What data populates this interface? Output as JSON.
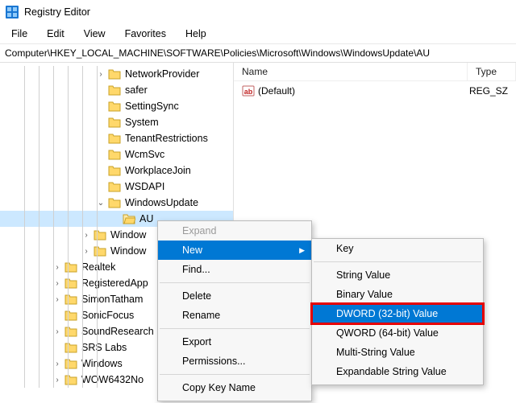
{
  "titlebar": {
    "title": "Registry Editor"
  },
  "menus": {
    "file": "File",
    "edit": "Edit",
    "view": "View",
    "favorites": "Favorites",
    "help": "Help"
  },
  "address": "Computer\\HKEY_LOCAL_MACHINE\\SOFTWARE\\Policies\\Microsoft\\Windows\\WindowsUpdate\\AU",
  "list": {
    "col_name": "Name",
    "col_type": "Type",
    "rows": [
      {
        "name": "(Default)",
        "type": "REG_SZ"
      }
    ]
  },
  "tree": [
    {
      "depth": 6,
      "chev": ">",
      "label": "NetworkProvider"
    },
    {
      "depth": 6,
      "chev": "",
      "label": "safer"
    },
    {
      "depth": 6,
      "chev": "",
      "label": "SettingSync"
    },
    {
      "depth": 6,
      "chev": "",
      "label": "System"
    },
    {
      "depth": 6,
      "chev": "",
      "label": "TenantRestrictions"
    },
    {
      "depth": 6,
      "chev": "",
      "label": "WcmSvc"
    },
    {
      "depth": 6,
      "chev": "",
      "label": "WorkplaceJoin"
    },
    {
      "depth": 6,
      "chev": "",
      "label": "WSDAPI"
    },
    {
      "depth": 6,
      "chev": "v",
      "label": "WindowsUpdate"
    },
    {
      "depth": 7,
      "chev": "",
      "label": "AU",
      "selected": true
    },
    {
      "depth": 5,
      "chev": ">",
      "label": "Window"
    },
    {
      "depth": 5,
      "chev": ">",
      "label": "Window"
    },
    {
      "depth": 3,
      "chev": ">",
      "label": "Realtek"
    },
    {
      "depth": 3,
      "chev": ">",
      "label": "RegisteredApp"
    },
    {
      "depth": 3,
      "chev": ">",
      "label": "SimonTatham"
    },
    {
      "depth": 3,
      "chev": "",
      "label": "SonicFocus"
    },
    {
      "depth": 3,
      "chev": ">",
      "label": "SoundResearch"
    },
    {
      "depth": 3,
      "chev": "",
      "label": "SRS Labs"
    },
    {
      "depth": 3,
      "chev": ">",
      "label": "Windows"
    },
    {
      "depth": 3,
      "chev": ">",
      "label": "WOW6432No"
    }
  ],
  "ctx1": {
    "expand": "Expand",
    "new": "New",
    "find": "Find...",
    "delete": "Delete",
    "rename": "Rename",
    "export": "Export",
    "permissions": "Permissions...",
    "copykey": "Copy Key Name"
  },
  "ctx2": {
    "key": "Key",
    "string": "String Value",
    "binary": "Binary Value",
    "dword": "DWORD (32-bit) Value",
    "qword": "QWORD (64-bit) Value",
    "multi": "Multi-String Value",
    "expand": "Expandable String Value"
  }
}
